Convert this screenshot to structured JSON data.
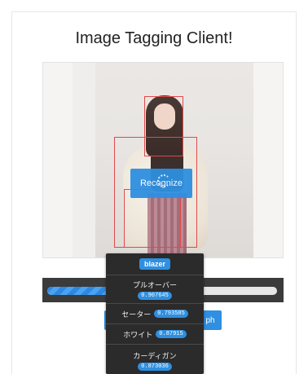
{
  "page": {
    "title": "Image Tagging Client!"
  },
  "photo": {
    "alt_semantic": "person-photo"
  },
  "buttons": {
    "recognize_label": "Recognize",
    "bottom_left_label": "",
    "bottom_right_label": "ph"
  },
  "progress": {
    "fraction": 0.36
  },
  "popup": {
    "selected_tag": "blazer",
    "tags": [
      {
        "label": "プルオーバー",
        "score": "0.907645",
        "layout": "stacked"
      },
      {
        "label": "セーター",
        "score": "0.793585",
        "layout": "inline"
      },
      {
        "label": "ホワイト",
        "score": "0.87915",
        "layout": "inline"
      },
      {
        "label": "カーディガン",
        "score": "0.873036",
        "layout": "stacked"
      }
    ]
  },
  "colors": {
    "accent": "#2f8fe0",
    "box_red": "#e04a4a",
    "popup_bg": "#2b2b2b"
  }
}
